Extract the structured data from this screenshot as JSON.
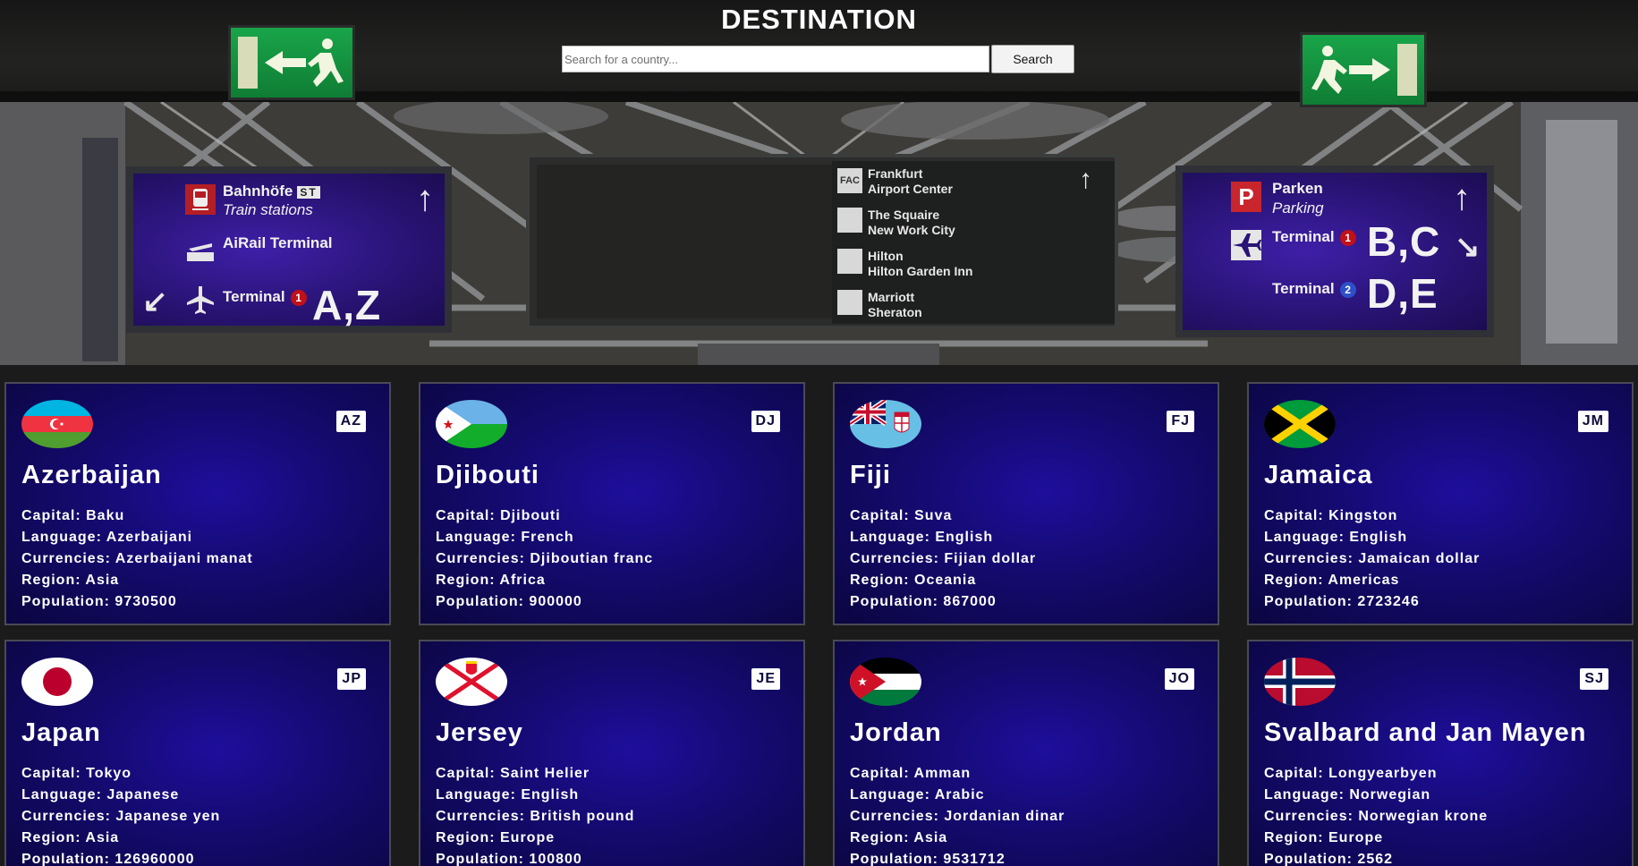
{
  "header": {
    "title": "DESTINATION",
    "search_placeholder": "Search for a country...",
    "search_button_label": "Search"
  },
  "hero_signs": {
    "left": {
      "line1": "Bahnhöfe",
      "line1_badge": "ST",
      "line1_sub": "Train stations",
      "line2": "AiRail Terminal",
      "line3": "Terminal",
      "line3_badge": "1",
      "line3_gates": "A,Z"
    },
    "center": {
      "items": [
        {
          "icon": "FAC",
          "title": "Frankfurt",
          "subtitle": "Airport Center"
        },
        {
          "icon": "",
          "title": "The Squaire",
          "subtitle": "New Work City"
        },
        {
          "icon": "",
          "title": "Hilton",
          "subtitle": "Hilton Garden Inn"
        },
        {
          "icon": "",
          "title": "Marriott",
          "subtitle": "Sheraton"
        }
      ]
    },
    "right": {
      "parking_icon": "P",
      "line1": "Parken",
      "line1_sub": "Parking",
      "line2": "Terminal",
      "line2_badge": "1",
      "line2_gates": "B,C",
      "line3": "Terminal",
      "line3_badge": "2",
      "line3_gates": "D,E"
    }
  },
  "countries": [
    {
      "code": "AZ",
      "name": "Azerbaijan",
      "flag": "azerbaijan-flag",
      "capital": "Capital: Baku",
      "language": "Language: Azerbaijani",
      "currencies": "Currencies: Azerbaijani manat",
      "region": "Region: Asia",
      "population": "Population: 9730500"
    },
    {
      "code": "DJ",
      "name": "Djibouti",
      "flag": "djibouti-flag",
      "capital": "Capital: Djibouti",
      "language": "Language: French",
      "currencies": "Currencies: Djiboutian franc",
      "region": "Region: Africa",
      "population": "Population: 900000"
    },
    {
      "code": "FJ",
      "name": "Fiji",
      "flag": "fiji-flag",
      "capital": "Capital: Suva",
      "language": "Language: English",
      "currencies": "Currencies: Fijian dollar",
      "region": "Region: Oceania",
      "population": "Population: 867000"
    },
    {
      "code": "JM",
      "name": "Jamaica",
      "flag": "jamaica-flag",
      "capital": "Capital: Kingston",
      "language": "Language: English",
      "currencies": "Currencies: Jamaican dollar",
      "region": "Region: Americas",
      "population": "Population: 2723246"
    },
    {
      "code": "JP",
      "name": "Japan",
      "flag": "japan-flag",
      "capital": "Capital: Tokyo",
      "language": "Language: Japanese",
      "currencies": "Currencies: Japanese yen",
      "region": "Region: Asia",
      "population": "Population: 126960000"
    },
    {
      "code": "JE",
      "name": "Jersey",
      "flag": "jersey-flag",
      "capital": "Capital: Saint Helier",
      "language": "Language: English",
      "currencies": "Currencies: British pound",
      "region": "Region: Europe",
      "population": "Population: 100800"
    },
    {
      "code": "JO",
      "name": "Jordan",
      "flag": "jordan-flag",
      "capital": "Capital: Amman",
      "language": "Language: Arabic",
      "currencies": "Currencies: Jordanian dinar",
      "region": "Region: Asia",
      "population": "Population: 9531712"
    },
    {
      "code": "SJ",
      "name": "Svalbard and Jan Mayen",
      "flag": "norway-flag",
      "capital": "Capital: Longyearbyen",
      "language": "Language: Norwegian",
      "currencies": "Currencies: Norwegian krone",
      "region": "Region: Europe",
      "population": "Population: 2562"
    }
  ],
  "colors": {
    "card_bg": "#140a6e",
    "page_bg": "#1b1b1b",
    "sign_purple": "#2a1477",
    "exit_green": "#19a54a"
  }
}
